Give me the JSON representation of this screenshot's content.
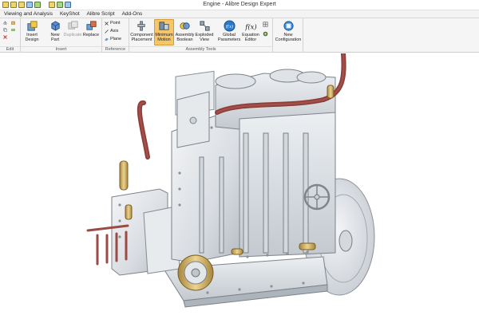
{
  "window": {
    "title": "Engine - Alibre Design Expert"
  },
  "menu": {
    "tabs": [
      "Viewing and Analysis",
      "KeyShot",
      "Alibre Script",
      "Add-Ons"
    ]
  },
  "ribbon": {
    "groups": {
      "edit": "Edit",
      "insert": "Insert",
      "reference": "Reference",
      "assembly_tools": "Assembly Tools"
    },
    "buttons": {
      "insert_design": [
        "Insert",
        "Design"
      ],
      "new_part": [
        "New",
        "Part"
      ],
      "duplicate": "Duplicate",
      "replace": "Replace",
      "point": "Point",
      "axis": "Axis",
      "plane": "Plane",
      "component_placement": [
        "Component",
        "Placement"
      ],
      "minimum_motion": [
        "Minimum",
        "Motion"
      ],
      "assembly_boolean": [
        "Assembly",
        "Boolean"
      ],
      "exploded_view": [
        "Exploded",
        "View"
      ],
      "global_parameters": [
        "Global",
        "Parameters"
      ],
      "equation_editor": [
        "Equation",
        "Editor"
      ],
      "new_configuration": [
        "New",
        "Configuration"
      ]
    }
  },
  "icons": {
    "global_parameters": "f(x)-circle-icon",
    "equation_editor": "f(x)"
  },
  "colors": {
    "active_button": "#f6c66b",
    "ribbon_bg": "#f5f5f5",
    "viewport_bg": "#ffffff",
    "pipe": "#9b4a45",
    "brass": "#c9a85a",
    "engine_body": "#e3e6ea"
  }
}
